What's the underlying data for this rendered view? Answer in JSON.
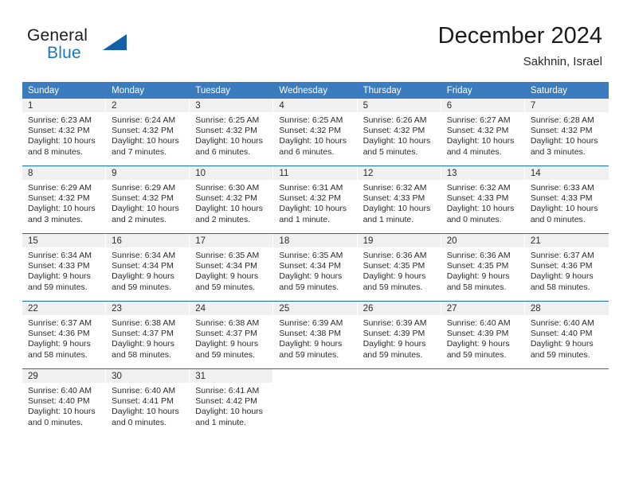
{
  "brand": {
    "name_part1": "General",
    "name_part2": "Blue",
    "logo_icon": "triangle-flag-icon"
  },
  "header": {
    "title": "December 2024",
    "subtitle": "Sakhnin, Israel"
  },
  "colors": {
    "header_blue": "#3b7cc0",
    "separator_blue": "#1b6eb0",
    "brand_blue": "#1b77bd",
    "daynum_bg": "#f0f0f0",
    "text": "#2b2b2b"
  },
  "calendar": {
    "weekday_headers": [
      "Sunday",
      "Monday",
      "Tuesday",
      "Wednesday",
      "Thursday",
      "Friday",
      "Saturday"
    ],
    "labels": {
      "sunrise": "Sunrise:",
      "sunset": "Sunset:",
      "daylight": "Daylight:"
    },
    "weeks": [
      [
        {
          "day": "1",
          "sunrise": "Sunrise: 6:23 AM",
          "sunset": "Sunset: 4:32 PM",
          "daylight1": "Daylight: 10 hours",
          "daylight2": "and 8 minutes."
        },
        {
          "day": "2",
          "sunrise": "Sunrise: 6:24 AM",
          "sunset": "Sunset: 4:32 PM",
          "daylight1": "Daylight: 10 hours",
          "daylight2": "and 7 minutes."
        },
        {
          "day": "3",
          "sunrise": "Sunrise: 6:25 AM",
          "sunset": "Sunset: 4:32 PM",
          "daylight1": "Daylight: 10 hours",
          "daylight2": "and 6 minutes."
        },
        {
          "day": "4",
          "sunrise": "Sunrise: 6:25 AM",
          "sunset": "Sunset: 4:32 PM",
          "daylight1": "Daylight: 10 hours",
          "daylight2": "and 6 minutes."
        },
        {
          "day": "5",
          "sunrise": "Sunrise: 6:26 AM",
          "sunset": "Sunset: 4:32 PM",
          "daylight1": "Daylight: 10 hours",
          "daylight2": "and 5 minutes."
        },
        {
          "day": "6",
          "sunrise": "Sunrise: 6:27 AM",
          "sunset": "Sunset: 4:32 PM",
          "daylight1": "Daylight: 10 hours",
          "daylight2": "and 4 minutes."
        },
        {
          "day": "7",
          "sunrise": "Sunrise: 6:28 AM",
          "sunset": "Sunset: 4:32 PM",
          "daylight1": "Daylight: 10 hours",
          "daylight2": "and 3 minutes."
        }
      ],
      [
        {
          "day": "8",
          "sunrise": "Sunrise: 6:29 AM",
          "sunset": "Sunset: 4:32 PM",
          "daylight1": "Daylight: 10 hours",
          "daylight2": "and 3 minutes."
        },
        {
          "day": "9",
          "sunrise": "Sunrise: 6:29 AM",
          "sunset": "Sunset: 4:32 PM",
          "daylight1": "Daylight: 10 hours",
          "daylight2": "and 2 minutes."
        },
        {
          "day": "10",
          "sunrise": "Sunrise: 6:30 AM",
          "sunset": "Sunset: 4:32 PM",
          "daylight1": "Daylight: 10 hours",
          "daylight2": "and 2 minutes."
        },
        {
          "day": "11",
          "sunrise": "Sunrise: 6:31 AM",
          "sunset": "Sunset: 4:32 PM",
          "daylight1": "Daylight: 10 hours",
          "daylight2": "and 1 minute."
        },
        {
          "day": "12",
          "sunrise": "Sunrise: 6:32 AM",
          "sunset": "Sunset: 4:33 PM",
          "daylight1": "Daylight: 10 hours",
          "daylight2": "and 1 minute."
        },
        {
          "day": "13",
          "sunrise": "Sunrise: 6:32 AM",
          "sunset": "Sunset: 4:33 PM",
          "daylight1": "Daylight: 10 hours",
          "daylight2": "and 0 minutes."
        },
        {
          "day": "14",
          "sunrise": "Sunrise: 6:33 AM",
          "sunset": "Sunset: 4:33 PM",
          "daylight1": "Daylight: 10 hours",
          "daylight2": "and 0 minutes."
        }
      ],
      [
        {
          "day": "15",
          "sunrise": "Sunrise: 6:34 AM",
          "sunset": "Sunset: 4:33 PM",
          "daylight1": "Daylight: 9 hours",
          "daylight2": "and 59 minutes."
        },
        {
          "day": "16",
          "sunrise": "Sunrise: 6:34 AM",
          "sunset": "Sunset: 4:34 PM",
          "daylight1": "Daylight: 9 hours",
          "daylight2": "and 59 minutes."
        },
        {
          "day": "17",
          "sunrise": "Sunrise: 6:35 AM",
          "sunset": "Sunset: 4:34 PM",
          "daylight1": "Daylight: 9 hours",
          "daylight2": "and 59 minutes."
        },
        {
          "day": "18",
          "sunrise": "Sunrise: 6:35 AM",
          "sunset": "Sunset: 4:34 PM",
          "daylight1": "Daylight: 9 hours",
          "daylight2": "and 59 minutes."
        },
        {
          "day": "19",
          "sunrise": "Sunrise: 6:36 AM",
          "sunset": "Sunset: 4:35 PM",
          "daylight1": "Daylight: 9 hours",
          "daylight2": "and 59 minutes."
        },
        {
          "day": "20",
          "sunrise": "Sunrise: 6:36 AM",
          "sunset": "Sunset: 4:35 PM",
          "daylight1": "Daylight: 9 hours",
          "daylight2": "and 58 minutes."
        },
        {
          "day": "21",
          "sunrise": "Sunrise: 6:37 AM",
          "sunset": "Sunset: 4:36 PM",
          "daylight1": "Daylight: 9 hours",
          "daylight2": "and 58 minutes."
        }
      ],
      [
        {
          "day": "22",
          "sunrise": "Sunrise: 6:37 AM",
          "sunset": "Sunset: 4:36 PM",
          "daylight1": "Daylight: 9 hours",
          "daylight2": "and 58 minutes."
        },
        {
          "day": "23",
          "sunrise": "Sunrise: 6:38 AM",
          "sunset": "Sunset: 4:37 PM",
          "daylight1": "Daylight: 9 hours",
          "daylight2": "and 58 minutes."
        },
        {
          "day": "24",
          "sunrise": "Sunrise: 6:38 AM",
          "sunset": "Sunset: 4:37 PM",
          "daylight1": "Daylight: 9 hours",
          "daylight2": "and 59 minutes."
        },
        {
          "day": "25",
          "sunrise": "Sunrise: 6:39 AM",
          "sunset": "Sunset: 4:38 PM",
          "daylight1": "Daylight: 9 hours",
          "daylight2": "and 59 minutes."
        },
        {
          "day": "26",
          "sunrise": "Sunrise: 6:39 AM",
          "sunset": "Sunset: 4:39 PM",
          "daylight1": "Daylight: 9 hours",
          "daylight2": "and 59 minutes."
        },
        {
          "day": "27",
          "sunrise": "Sunrise: 6:40 AM",
          "sunset": "Sunset: 4:39 PM",
          "daylight1": "Daylight: 9 hours",
          "daylight2": "and 59 minutes."
        },
        {
          "day": "28",
          "sunrise": "Sunrise: 6:40 AM",
          "sunset": "Sunset: 4:40 PM",
          "daylight1": "Daylight: 9 hours",
          "daylight2": "and 59 minutes."
        }
      ],
      [
        {
          "day": "29",
          "sunrise": "Sunrise: 6:40 AM",
          "sunset": "Sunset: 4:40 PM",
          "daylight1": "Daylight: 10 hours",
          "daylight2": "and 0 minutes."
        },
        {
          "day": "30",
          "sunrise": "Sunrise: 6:40 AM",
          "sunset": "Sunset: 4:41 PM",
          "daylight1": "Daylight: 10 hours",
          "daylight2": "and 0 minutes."
        },
        {
          "day": "31",
          "sunrise": "Sunrise: 6:41 AM",
          "sunset": "Sunset: 4:42 PM",
          "daylight1": "Daylight: 10 hours",
          "daylight2": "and 1 minute."
        },
        {
          "day": "",
          "sunrise": "",
          "sunset": "",
          "daylight1": "",
          "daylight2": ""
        },
        {
          "day": "",
          "sunrise": "",
          "sunset": "",
          "daylight1": "",
          "daylight2": ""
        },
        {
          "day": "",
          "sunrise": "",
          "sunset": "",
          "daylight1": "",
          "daylight2": ""
        },
        {
          "day": "",
          "sunrise": "",
          "sunset": "",
          "daylight1": "",
          "daylight2": ""
        }
      ]
    ]
  }
}
